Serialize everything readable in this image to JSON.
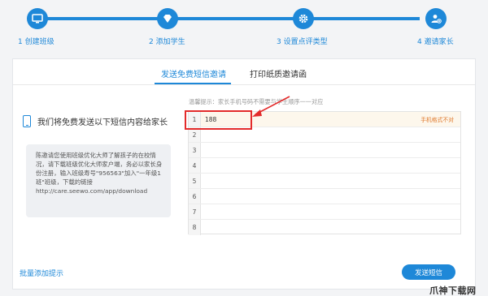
{
  "stepper": {
    "accent": "#1e88d8",
    "steps": [
      {
        "label": "1 创建班级",
        "icon": "monitor-icon"
      },
      {
        "label": "2 添加学生",
        "icon": "diamond-icon"
      },
      {
        "label": "3 设置点评类型",
        "icon": "gear-icon"
      },
      {
        "label": "4 邀请家长",
        "icon": "add-user-icon"
      }
    ]
  },
  "tabs": [
    {
      "label": "发送免费短信邀请",
      "active": true
    },
    {
      "label": "打印纸质邀请函",
      "active": false
    }
  ],
  "left": {
    "title": "我们将免费发送以下短信内容给家长",
    "message": "陈邀请您使用班级优化大师了解孩子的在校情况，请下载班级优化大师家户端，务必以家长身份注册，输入班级寿号\"956563\"加入\"一年级1班\"班级，下载的链接",
    "link": "http://care.seewo.com/app/download"
  },
  "hint": "温馨提示：家长手机号码不需要与学生顺序一一对应",
  "phone_table": {
    "rows": [
      {
        "num": "1",
        "value": "188",
        "error": "手机格式不对"
      },
      {
        "num": "2",
        "value": "",
        "error": ""
      },
      {
        "num": "3",
        "value": "",
        "error": ""
      },
      {
        "num": "4",
        "value": "",
        "error": ""
      },
      {
        "num": "5",
        "value": "",
        "error": ""
      },
      {
        "num": "6",
        "value": "",
        "error": ""
      },
      {
        "num": "7",
        "value": "",
        "error": ""
      },
      {
        "num": "8",
        "value": "",
        "error": ""
      }
    ]
  },
  "footer": {
    "bulk_link": "批量添加提示",
    "send_button": "发送短信"
  },
  "watermark": "爪神下载网"
}
